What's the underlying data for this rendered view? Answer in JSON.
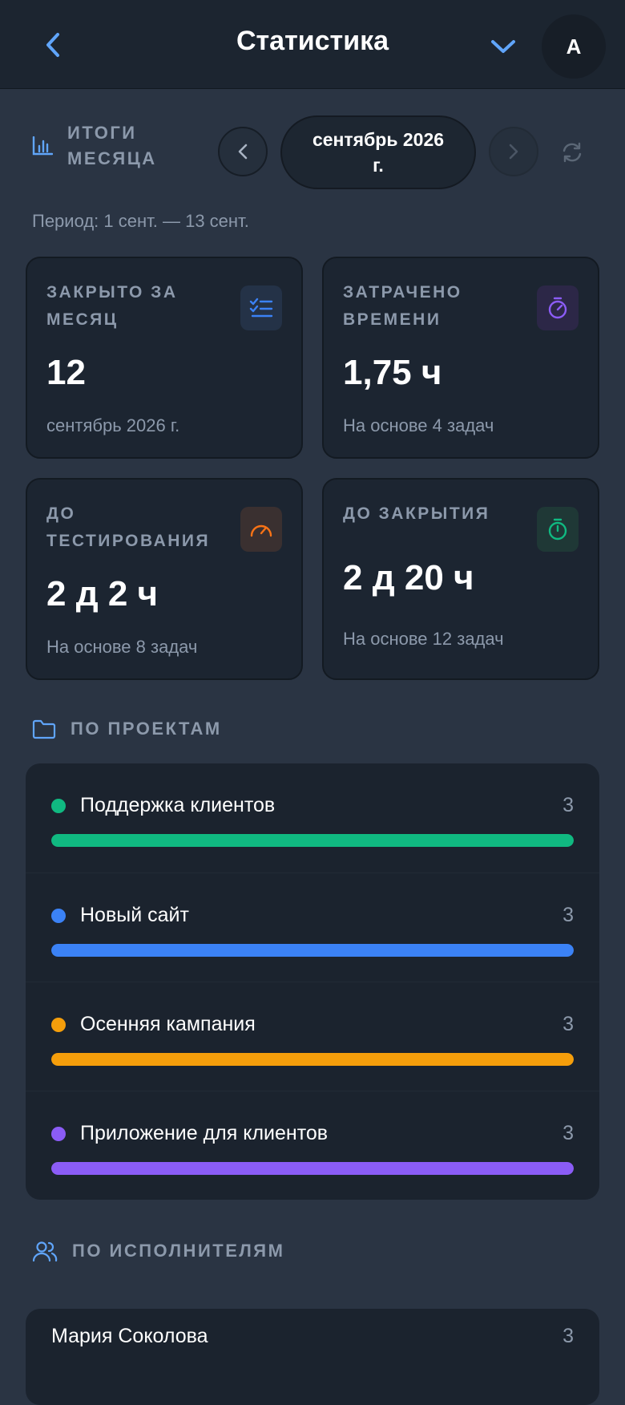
{
  "header": {
    "title": "Статистика",
    "avatar_letter": "A",
    "accent_color": "#60a5fa"
  },
  "summary": {
    "title": "ИТОГИ МЕСЯЦА",
    "month": "сентябрь 2026 г.",
    "period": "Период: 1 сент. — 13 сент."
  },
  "cards": [
    {
      "label": "ЗАКРЫТО ЗА МЕСЯЦ",
      "value": "12",
      "note": "сентябрь 2026 г.",
      "icon": "checklist-icon",
      "color": "#3b82f6"
    },
    {
      "label": "ЗАТРАЧЕНО ВРЕМЕНИ",
      "value": "1,75 ч",
      "note": "На основе 4 задач",
      "icon": "stopwatch-icon",
      "color": "#8b5cf6"
    },
    {
      "label": "ДО ТЕСТИРОВАНИЯ",
      "value": "2 д 2 ч",
      "note": "На основе 8 задач",
      "icon": "speedometer-icon",
      "color": "#f97316"
    },
    {
      "label": "ДО ЗАКРЫТИЯ",
      "value": "2 д 20 ч",
      "note": "На основе 12 задач",
      "icon": "timer-icon",
      "color": "#10b981"
    }
  ],
  "projects": {
    "title": "ПО ПРОЕКТАМ",
    "items": [
      {
        "name": "Поддержка клиентов",
        "count": "3",
        "color": "#10b981",
        "share": 1.0
      },
      {
        "name": "Новый сайт",
        "count": "3",
        "color": "#3b82f6",
        "share": 1.0
      },
      {
        "name": "Осенняя кампания",
        "count": "3",
        "color": "#f59e0b",
        "share": 1.0
      },
      {
        "name": "Приложение для клиентов",
        "count": "3",
        "color": "#8b5cf6",
        "share": 1.0
      }
    ]
  },
  "assignees": {
    "title": "ПО ИСПОЛНИТЕЛЯМ",
    "items": [
      {
        "name": "Мария Соколова",
        "count": "3"
      }
    ]
  }
}
